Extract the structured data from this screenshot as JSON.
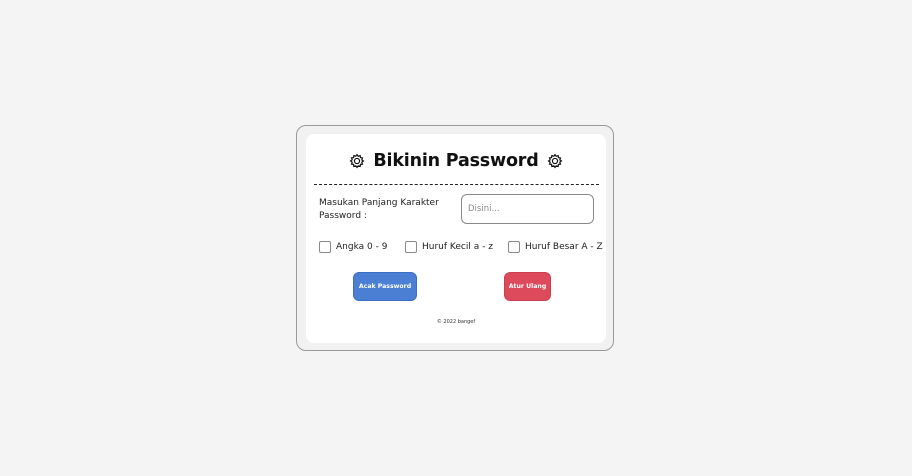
{
  "app": {
    "title": "Bikinin Password",
    "footer": "© 2022 bangef"
  },
  "form": {
    "length_label": "Masukan Panjang Karakter Password :",
    "length_placeholder": "Disini...",
    "length_value": ""
  },
  "options": [
    {
      "label": "Angka 0 - 9",
      "checked": false
    },
    {
      "label": "Huruf Kecil a - z",
      "checked": false
    },
    {
      "label": "Huruf Besar A - Z",
      "checked": false
    }
  ],
  "buttons": {
    "generate_label": "Acak Password",
    "reset_label": "Atur Ulang"
  },
  "colors": {
    "generate": "#4a7fd3",
    "reset": "#dc4a5c",
    "background": "#f4f4f4"
  },
  "icons": {
    "title_left": "gear-icon",
    "title_right": "gear-icon"
  }
}
